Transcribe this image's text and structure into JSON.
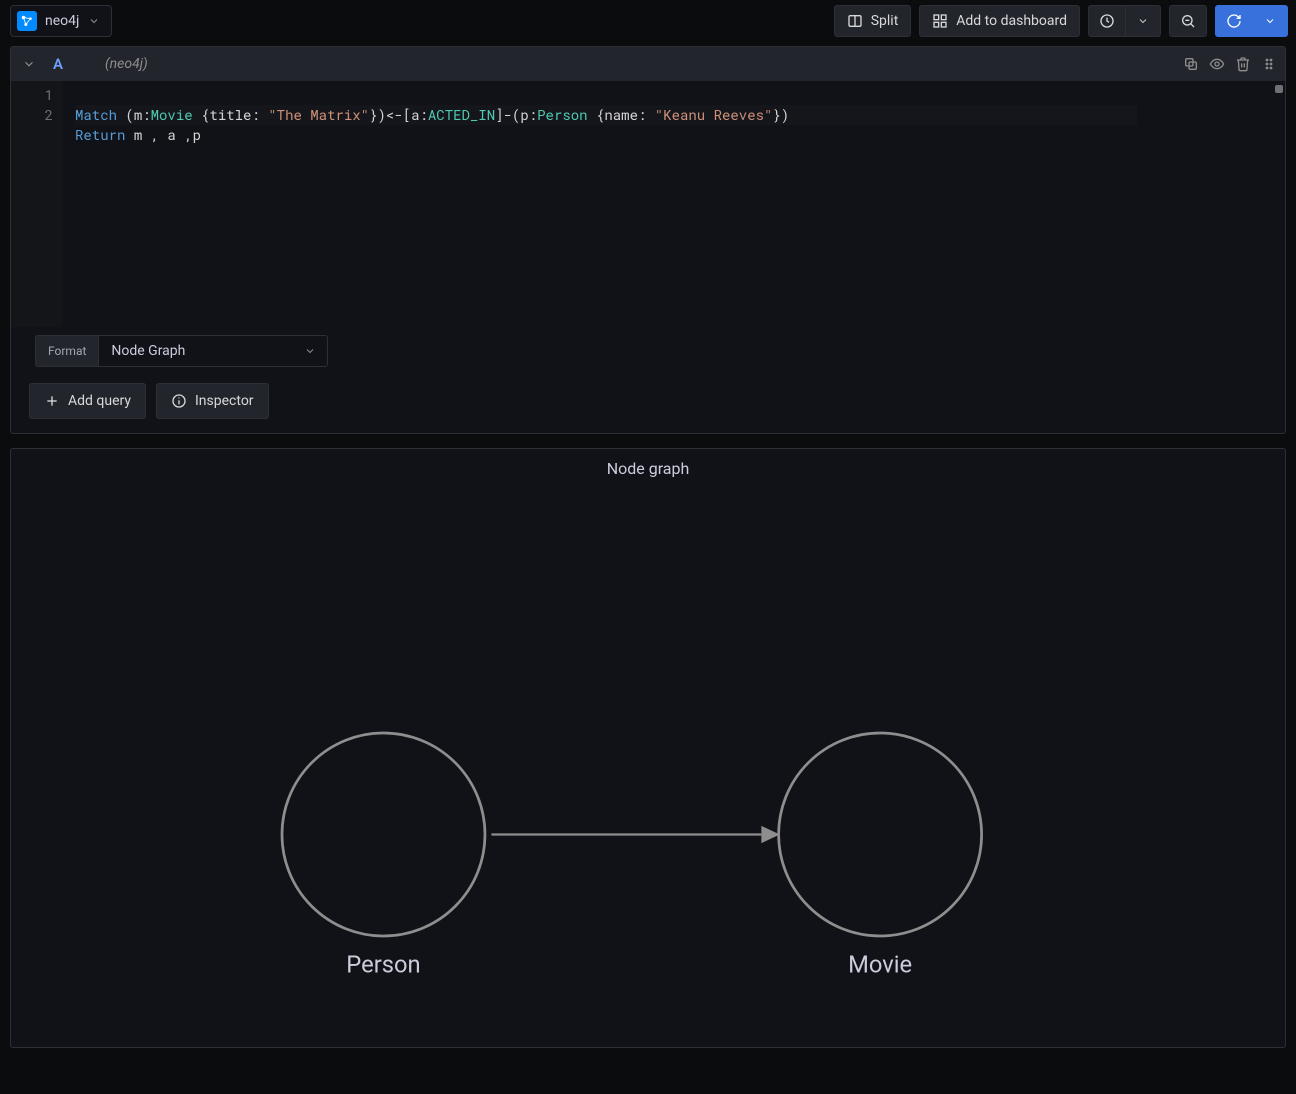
{
  "datasource": {
    "name": "neo4j"
  },
  "toolbar": {
    "split_label": "Split",
    "add_dashboard_label": "Add to dashboard"
  },
  "query": {
    "letter": "A",
    "ds_label": "(neo4j)",
    "lines": {
      "l1": {
        "kw_match": "Match",
        "seg1": " (m:",
        "label_movie": "Movie",
        "seg2": " {title: ",
        "str_matrix": "\"The Matrix\"",
        "seg3": "})<-[a:",
        "label_acted": "ACTED_IN",
        "seg4": "]-(p:",
        "label_person": "Person",
        "seg5": " {name: ",
        "str_keanu": "\"Keanu Reeves\"",
        "seg6": "})"
      },
      "l2": {
        "kw_return": "Return",
        "rest": " m , a ,p"
      }
    },
    "gutter": [
      "1",
      "2"
    ]
  },
  "format": {
    "label": "Format",
    "selected": "Node Graph"
  },
  "actions": {
    "add_query": "Add query",
    "inspector": "Inspector"
  },
  "graph": {
    "title": "Node graph",
    "node_a_label": "Person",
    "node_b_label": "Movie"
  }
}
